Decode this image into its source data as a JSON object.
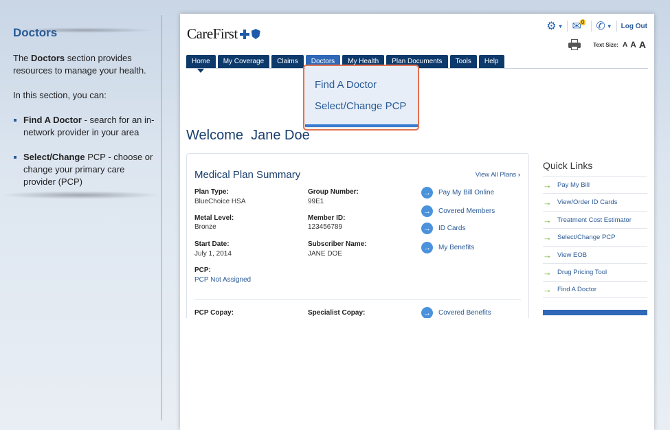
{
  "tutorial": {
    "title": "Doctors",
    "intro_pre": "The ",
    "intro_bold": "Doctors",
    "intro_post": " section provides resources to manage your health.",
    "lead": "In this section, you can:",
    "bullets": [
      {
        "bold": "Find A Doctor",
        "text": " - search for an in-network provider in your area"
      },
      {
        "bold": "Select/Change",
        "text": " PCP - choose or change your primary care provider (PCP)"
      }
    ]
  },
  "brand": {
    "name": "CareFirst"
  },
  "utilities": {
    "mail_count": "0",
    "logout": "Log Out",
    "text_size_label": "Text Size:",
    "sizes": [
      "A",
      "A",
      "A"
    ]
  },
  "nav": {
    "tabs": [
      "Home",
      "My Coverage",
      "Claims",
      "Doctors",
      "My Health",
      "Plan Documents",
      "Tools",
      "Help"
    ],
    "dropdown": [
      "Find A Doctor",
      "Select/Change PCP"
    ]
  },
  "welcome": {
    "prefix": "Welcome",
    "name": "Jane Doe"
  },
  "summary": {
    "title": "Medical Plan Summary",
    "view_all": "View All Plans",
    "fields": [
      {
        "label": "Plan Type:",
        "value": "BlueChoice HSA"
      },
      {
        "label": "Group Number:",
        "value": "99E1"
      },
      {
        "label": "Metal Level:",
        "value": "Bronze"
      },
      {
        "label": "Member ID:",
        "value": "123456789"
      },
      {
        "label": "Start Date:",
        "value": "July 1, 2014"
      },
      {
        "label": "Subscriber Name:",
        "value": "JANE DOE"
      },
      {
        "label": "PCP:",
        "value": "PCP Not Assigned"
      }
    ],
    "action_links": [
      "Pay My Bill Online",
      "Covered Members",
      "ID Cards",
      "My Benefits"
    ],
    "copay": {
      "pcp": "PCP Copay:",
      "specialist": "Specialist Copay:",
      "covered": "Covered Benefits"
    }
  },
  "quick_links": {
    "title": "Quick Links",
    "items": [
      "Pay My Bill",
      "View/Order ID Cards",
      "Treatment Cost Estimator",
      "Select/Change PCP",
      "View EOB",
      "Drug Pricing Tool",
      "Find A Doctor"
    ]
  },
  "colors": {
    "brand_navy": "#0e3a6b",
    "active_tab": "#2e68b7",
    "link": "#2a5a96",
    "highlight": "#e0704f",
    "arrow_green": "#72b534"
  }
}
